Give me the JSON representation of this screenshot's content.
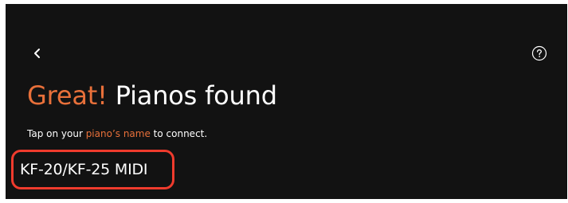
{
  "header": {
    "back_icon": "chevron-left-icon",
    "help_icon": "question-circle-icon"
  },
  "title": {
    "accent": "Great!",
    "rest": " Pianos found"
  },
  "subtitle": {
    "prefix": "Tap on your ",
    "accent": "piano’s name",
    "suffix": " to connect."
  },
  "devices": [
    {
      "name": "KF-20/KF-25 MIDI"
    }
  ],
  "colors": {
    "background": "#121212",
    "accent": "#e8703a",
    "highlight": "#ef3b2d",
    "text": "#ffffff"
  }
}
